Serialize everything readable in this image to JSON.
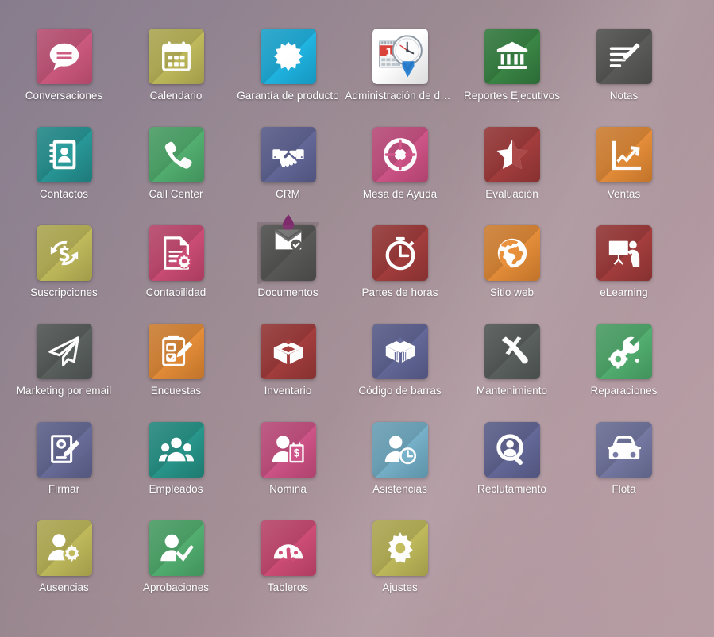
{
  "wallpaper": {
    "gradient_from": "#857a8b",
    "gradient_to": "#bda2a9",
    "accent_streak": "rgba(255,255,255,0.085)"
  },
  "grid": {
    "columns": 6,
    "rows": 6,
    "label_color": "#ffffff"
  },
  "apps": [
    {
      "label": "Conversaciones",
      "icon": "chat-bubble-icon",
      "tile_color": "#cf5c82",
      "tile_color_dark": "#b94b6e"
    },
    {
      "label": "Calendario",
      "icon": "calendar-icon",
      "tile_color": "#c3bd5e",
      "tile_color_dark": "#aaa44e"
    },
    {
      "label": "Garantía de producto",
      "icon": "starburst-seal-icon",
      "tile_color": "#22b8e6",
      "tile_color_dark": "#169fc9"
    },
    {
      "label": "Administración de documentos",
      "icon": "calendar-clock-check-icon",
      "tile_color": "#ffffff",
      "tile_color_dark": "#e9e9e9"
    },
    {
      "label": "Reportes Ejecutivos",
      "icon": "bank-building-icon",
      "tile_color": "#3c8a48",
      "tile_color_dark": "#2f7039"
    },
    {
      "label": "Notas",
      "icon": "note-pencil-icon",
      "tile_color": "#5d5d5c",
      "tile_color_dark": "#4c4c4b"
    },
    {
      "label": "Contactos",
      "icon": "address-book-icon",
      "tile_color": "#2a9b9b",
      "tile_color_dark": "#1f8080"
    },
    {
      "label": "Call Center",
      "icon": "phone-handset-icon",
      "tile_color": "#55b273",
      "tile_color_dark": "#449a60"
    },
    {
      "label": "CRM",
      "icon": "handshake-icon",
      "tile_color": "#656a9b",
      "tile_color_dark": "#545884"
    },
    {
      "label": "Mesa de Ayuda",
      "icon": "life-ring-icon",
      "tile_color": "#d1568a",
      "tile_color_dark": "#b94674"
    },
    {
      "label": "Evaluación",
      "icon": "half-star-icon",
      "tile_color": "#a83f3f",
      "tile_color_dark": "#8e3333"
    },
    {
      "label": "Ventas",
      "icon": "trending-chart-icon",
      "tile_color": "#e8903b",
      "tile_color_dark": "#cc7a2c"
    },
    {
      "label": "Suscripciones",
      "icon": "dollar-refresh-icon",
      "tile_color": "#c3bd5e",
      "tile_color_dark": "#aaa44e"
    },
    {
      "label": "Contabilidad",
      "icon": "invoice-gear-icon",
      "tile_color": "#cf4f79",
      "tile_color_dark": "#b33f65"
    },
    {
      "label": "Documentos",
      "icon": "document-tray-drop-icon",
      "tile_color": "#5b5b5a",
      "tile_color_dark": "#4b4b4a"
    },
    {
      "label": "Partes de horas",
      "icon": "stopwatch-icon",
      "tile_color": "#a83f3f",
      "tile_color_dark": "#8e3333"
    },
    {
      "label": "Sitio web",
      "icon": "globe-icon",
      "tile_color": "#e8903b",
      "tile_color_dark": "#cc7a2c"
    },
    {
      "label": "eLearning",
      "icon": "presentation-teacher-icon",
      "tile_color": "#a83f3f",
      "tile_color_dark": "#8e3333"
    },
    {
      "label": "Marketing por email",
      "icon": "paper-plane-icon",
      "tile_color": "#5d6360",
      "tile_color_dark": "#4c5250"
    },
    {
      "label": "Encuestas",
      "icon": "clipboard-pencil-icon",
      "tile_color": "#e8903b",
      "tile_color_dark": "#cc7a2c"
    },
    {
      "label": "Inventario",
      "icon": "open-box-icon",
      "tile_color": "#a83f3f",
      "tile_color_dark": "#8e3333"
    },
    {
      "label": "Código de barras",
      "icon": "box-barcode-icon",
      "tile_color": "#656a9b",
      "tile_color_dark": "#545884"
    },
    {
      "label": "Mantenimiento",
      "icon": "hammer-screwdriver-icon",
      "tile_color": "#5d6360",
      "tile_color_dark": "#4c5250"
    },
    {
      "label": "Reparaciones",
      "icon": "wrench-gear-icon",
      "tile_color": "#55b273",
      "tile_color_dark": "#449a60"
    },
    {
      "label": "Firmar",
      "icon": "sign-document-icon",
      "tile_color": "#6b6f9c",
      "tile_color_dark": "#585c84"
    },
    {
      "label": "Empleados",
      "icon": "people-group-icon",
      "tile_color": "#2a9b8f",
      "tile_color_dark": "#1f8076"
    },
    {
      "label": "Nómina",
      "icon": "person-money-icon",
      "tile_color": "#d1568a",
      "tile_color_dark": "#b94674"
    },
    {
      "label": "Asistencias",
      "icon": "person-clock-icon",
      "tile_color": "#79b4cc",
      "tile_color_dark": "#649bb2"
    },
    {
      "label": "Reclutamiento",
      "icon": "person-search-icon",
      "tile_color": "#676b9b",
      "tile_color_dark": "#555984"
    },
    {
      "label": "Flota",
      "icon": "car-icon",
      "tile_color": "#787ca6",
      "tile_color_dark": "#64688e"
    },
    {
      "label": "Ausencias",
      "icon": "person-gear-icon",
      "tile_color": "#c3bd5e",
      "tile_color_dark": "#aaa44e"
    },
    {
      "label": "Aprobaciones",
      "icon": "person-check-icon",
      "tile_color": "#55b273",
      "tile_color_dark": "#449a60"
    },
    {
      "label": "Tableros",
      "icon": "gauge-dashboard-icon",
      "tile_color": "#d14f79",
      "tile_color_dark": "#b84066"
    },
    {
      "label": "Ajustes",
      "icon": "gear-icon",
      "tile_color": "#c3bd5e",
      "tile_color_dark": "#aaa44e"
    }
  ]
}
